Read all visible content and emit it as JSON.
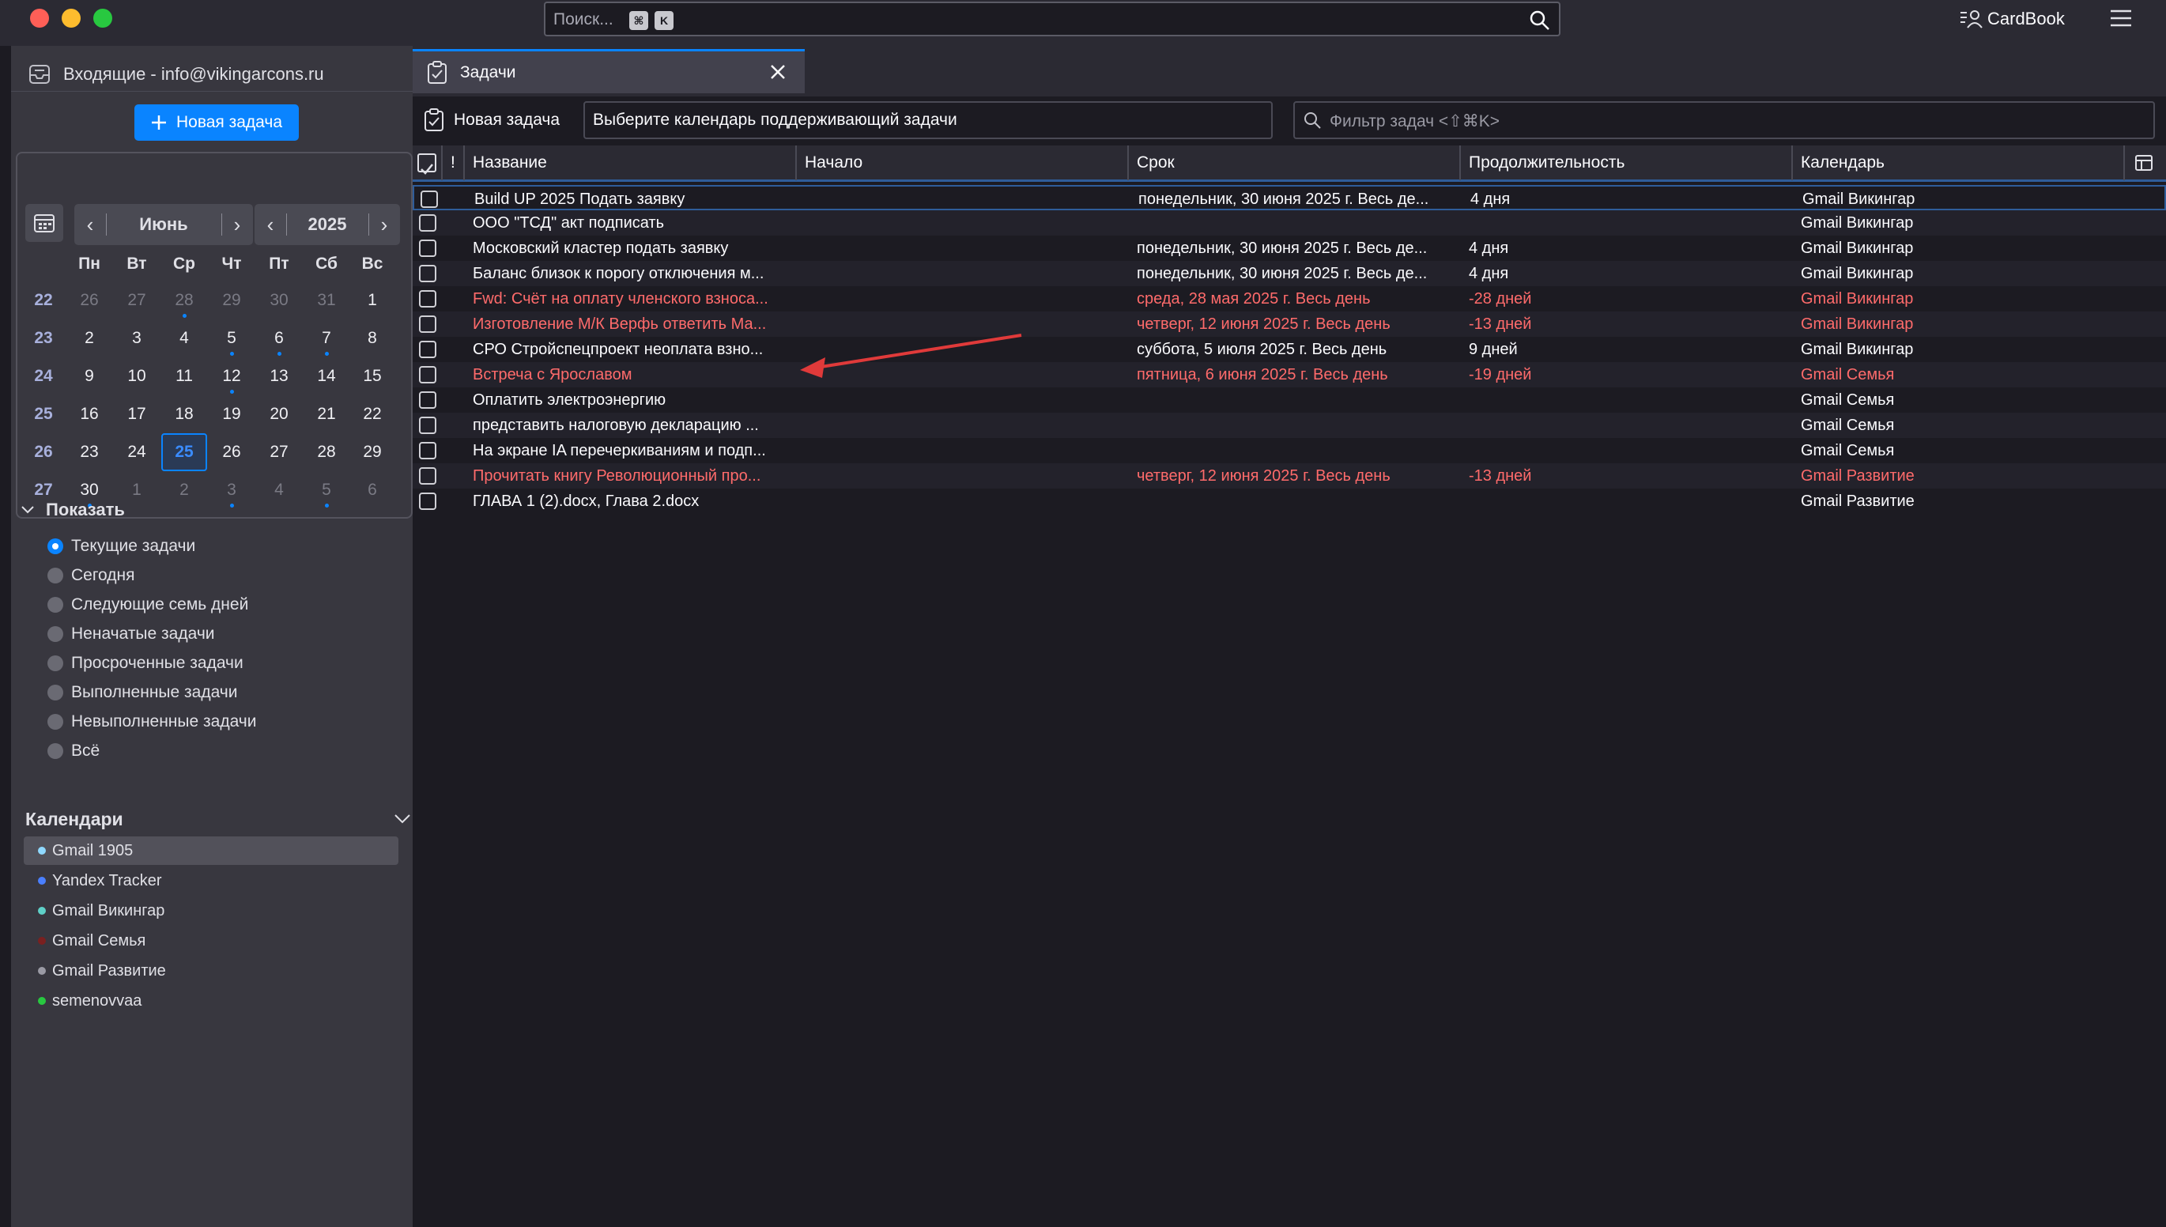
{
  "search": {
    "placeholder": "Поиск...",
    "key1": "⌘",
    "key2": "K"
  },
  "header": {
    "cardbook": "CardBook"
  },
  "left": {
    "inbox_label": "Входящие - info@vikingarcons.ru",
    "new_task": "Новая задача",
    "minical": {
      "month": "Июнь",
      "year": "2025",
      "dow": [
        "Пн",
        "Вт",
        "Ср",
        "Чт",
        "Пт",
        "Сб",
        "Вс"
      ],
      "weeks": [
        {
          "num": "22",
          "days": [
            {
              "d": "26",
              "other": true
            },
            {
              "d": "27",
              "other": true
            },
            {
              "d": "28",
              "other": true,
              "dot": true
            },
            {
              "d": "29",
              "other": true
            },
            {
              "d": "30",
              "other": true
            },
            {
              "d": "31",
              "other": true
            },
            {
              "d": "1"
            }
          ]
        },
        {
          "num": "23",
          "days": [
            {
              "d": "2"
            },
            {
              "d": "3"
            },
            {
              "d": "4"
            },
            {
              "d": "5",
              "dot": true
            },
            {
              "d": "6",
              "dot": true
            },
            {
              "d": "7",
              "dot": true
            },
            {
              "d": "8"
            }
          ]
        },
        {
          "num": "24",
          "days": [
            {
              "d": "9"
            },
            {
              "d": "10"
            },
            {
              "d": "11"
            },
            {
              "d": "12",
              "dot": true
            },
            {
              "d": "13"
            },
            {
              "d": "14"
            },
            {
              "d": "15"
            }
          ]
        },
        {
          "num": "25",
          "days": [
            {
              "d": "16"
            },
            {
              "d": "17"
            },
            {
              "d": "18"
            },
            {
              "d": "19"
            },
            {
              "d": "20"
            },
            {
              "d": "21"
            },
            {
              "d": "22"
            }
          ]
        },
        {
          "num": "26",
          "days": [
            {
              "d": "23"
            },
            {
              "d": "24"
            },
            {
              "d": "25",
              "today": true
            },
            {
              "d": "26"
            },
            {
              "d": "27"
            },
            {
              "d": "28"
            },
            {
              "d": "29"
            }
          ]
        },
        {
          "num": "27",
          "days": [
            {
              "d": "30",
              "dot": true
            },
            {
              "d": "1",
              "other": true
            },
            {
              "d": "2",
              "other": true
            },
            {
              "d": "3",
              "other": true,
              "dot": true
            },
            {
              "d": "4",
              "other": true
            },
            {
              "d": "5",
              "other": true,
              "dot": true
            },
            {
              "d": "6",
              "other": true
            }
          ]
        }
      ]
    },
    "show": {
      "title": "Показать",
      "options": [
        {
          "label": "Текущие задачи",
          "on": true
        },
        {
          "label": "Сегодня"
        },
        {
          "label": "Следующие семь дней"
        },
        {
          "label": "Неначатые задачи"
        },
        {
          "label": "Просроченные задачи"
        },
        {
          "label": "Выполненные задачи"
        },
        {
          "label": "Невыполненные задачи"
        },
        {
          "label": "Всё"
        }
      ]
    },
    "calendars": {
      "title": "Календари",
      "items": [
        {
          "label": "Gmail 1905",
          "color": "#8fd9ff",
          "sel": true
        },
        {
          "label": "Yandex Tracker",
          "color": "#4a7fff"
        },
        {
          "label": "Gmail Викингар",
          "color": "#5fd0c8"
        },
        {
          "label": "Gmail Семья",
          "color": "#7a2020"
        },
        {
          "label": "Gmail Развитие",
          "color": "#9a9aa4"
        },
        {
          "label": "semenovvaa",
          "color": "#28c840"
        }
      ]
    }
  },
  "tab": {
    "label": "Задачи"
  },
  "toolbar": {
    "new_task": "Новая задача",
    "calendar_select": "Выберите календарь поддерживающий задачи",
    "filter_placeholder": "Фильтр задач <⇧⌘K>"
  },
  "table": {
    "headers": {
      "priority": "!",
      "name": "Название",
      "start": "Начало",
      "due": "Срок",
      "duration": "Продолжительность",
      "calendar": "Календарь"
    },
    "rows": [
      {
        "name": "Build UP 2025 Подать заявку",
        "start": "",
        "due": "понедельник, 30 июня 2025 г. Весь де...",
        "duration": "4 дня",
        "calendar": "Gmail Викингар",
        "overdue": false
      },
      {
        "name": " ООО \"ТСД\" акт подписать",
        "start": "",
        "due": "",
        "duration": "",
        "calendar": "Gmail Викингар",
        "overdue": false
      },
      {
        "name": "Московский кластер подать заявку",
        "start": "",
        "due": "понедельник, 30 июня 2025 г. Весь де...",
        "duration": "4 дня",
        "calendar": "Gmail Викингар",
        "overdue": false
      },
      {
        "name": "Баланс близок к порогу отключения м...",
        "start": "",
        "due": "понедельник, 30 июня 2025 г. Весь де...",
        "duration": "4 дня",
        "calendar": "Gmail Викингар",
        "overdue": false
      },
      {
        "name": "Fwd: Счёт на оплату членского взноса...",
        "start": "",
        "due": "среда, 28 мая 2025 г. Весь день",
        "duration": "-28 дней",
        "calendar": "Gmail Викингар",
        "overdue": true
      },
      {
        "name": "Изготовление М/К Верфь ответить Ма...",
        "start": "",
        "due": "четверг, 12 июня 2025 г. Весь день",
        "duration": "-13 дней",
        "calendar": "Gmail Викингар",
        "overdue": true
      },
      {
        "name": "СРО Стройспецпроект неоплата взно...",
        "start": "",
        "due": "суббота, 5 июля 2025 г. Весь день",
        "duration": "9 дней",
        "calendar": "Gmail Викингар",
        "overdue": false
      },
      {
        "name": "Встреча с Ярославом",
        "start": "",
        "due": "пятница, 6 июня 2025 г. Весь день",
        "duration": "-19 дней",
        "calendar": "Gmail Семья",
        "overdue": true
      },
      {
        "name": "Оплатить электроэнергию",
        "start": "",
        "due": "",
        "duration": "",
        "calendar": "Gmail Семья",
        "overdue": false
      },
      {
        "name": "  представить налоговую декларацию ...",
        "start": "",
        "due": "",
        "duration": "",
        "calendar": "Gmail Семья",
        "overdue": false
      },
      {
        "name": "На экране IA перечеркиваниям и подп...",
        "start": "",
        "due": "",
        "duration": "",
        "calendar": "Gmail Семья",
        "overdue": false
      },
      {
        "name": "Прочитать книгу Революционный про...",
        "start": "",
        "due": "четверг, 12 июня 2025 г. Весь день",
        "duration": "-13 дней",
        "calendar": "Gmail Развитие",
        "overdue": true
      },
      {
        "name": "ГЛАВА 1 (2).docx, Глава 2.docx",
        "start": "",
        "due": "",
        "duration": "",
        "calendar": "Gmail Развитие",
        "overdue": false
      }
    ]
  },
  "colors": {
    "accent": "#0a84ff",
    "overdue": "#ff6b6b",
    "annotation_arrow": "#e03a3a"
  }
}
